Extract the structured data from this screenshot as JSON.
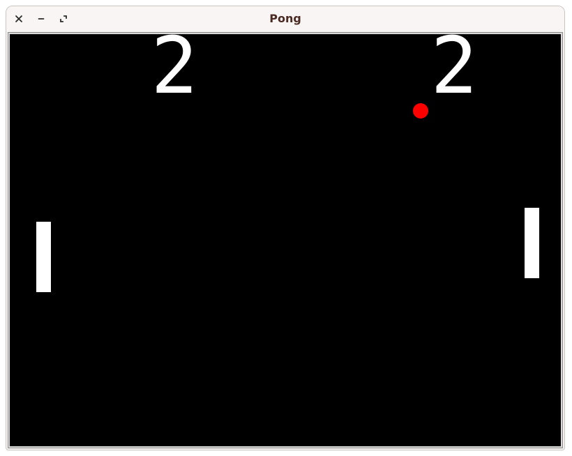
{
  "window": {
    "title": "Pong"
  },
  "titlebar": {
    "buttons": [
      "close-icon",
      "minimize-icon",
      "maximize-icon"
    ]
  },
  "game": {
    "score_left": "2",
    "score_right": "2",
    "colors": {
      "background": "#000000",
      "paddle": "#ffffff",
      "ball": "#ff0000",
      "score": "#ffffff"
    }
  }
}
